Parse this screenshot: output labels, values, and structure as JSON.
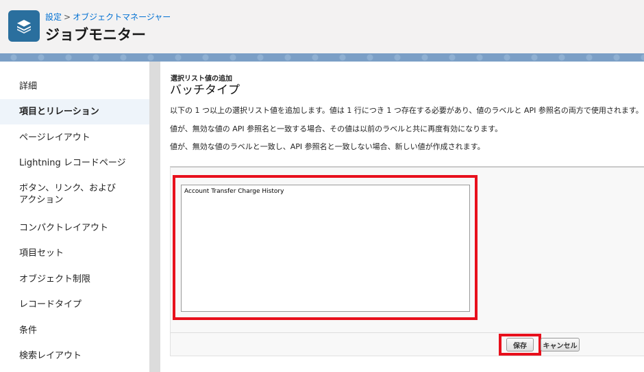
{
  "header": {
    "breadcrumb": {
      "setup": "設定",
      "separator": ">",
      "object_manager": "オブジェクトマネージャー"
    },
    "title": "ジョブモニター",
    "icon": "layers-icon"
  },
  "sidebar": {
    "items": [
      {
        "label": "詳細"
      },
      {
        "label": "項目とリレーション"
      },
      {
        "label": "ページレイアウト"
      },
      {
        "label": "Lightning レコードページ"
      },
      {
        "label": "ボタン、リンク、およびアクション"
      },
      {
        "label": "コンパクトレイアウト"
      },
      {
        "label": "項目セット"
      },
      {
        "label": "オブジェクト制限"
      },
      {
        "label": "レコードタイプ"
      },
      {
        "label": "条件"
      },
      {
        "label": "検索レイアウト"
      }
    ],
    "active_index": 1
  },
  "main": {
    "kicker": "選択リスト値の追加",
    "title": "バッチタイプ",
    "descriptions": [
      "以下の 1 つ以上の選択リスト値を追加します。値は 1 行につき 1 つ存在する必要があり、値のラベルと API 参照名の両方で使用されます。",
      "値が、無効な値の API 参照名と一致する場合、その値は以前のラベルと共に再度有効になります。",
      "値が、無効な値のラベルと一致し、API 参照名と一致しない場合、新しい値が作成されます。"
    ],
    "textarea_value": "Account Transfer Charge History",
    "save_label": "保存",
    "cancel_label": "キャンセル"
  },
  "colors": {
    "brand_icon": "#2a6f9e",
    "link": "#0070d2",
    "highlight_red": "#e8101c",
    "banner": "#7b9fc6"
  }
}
